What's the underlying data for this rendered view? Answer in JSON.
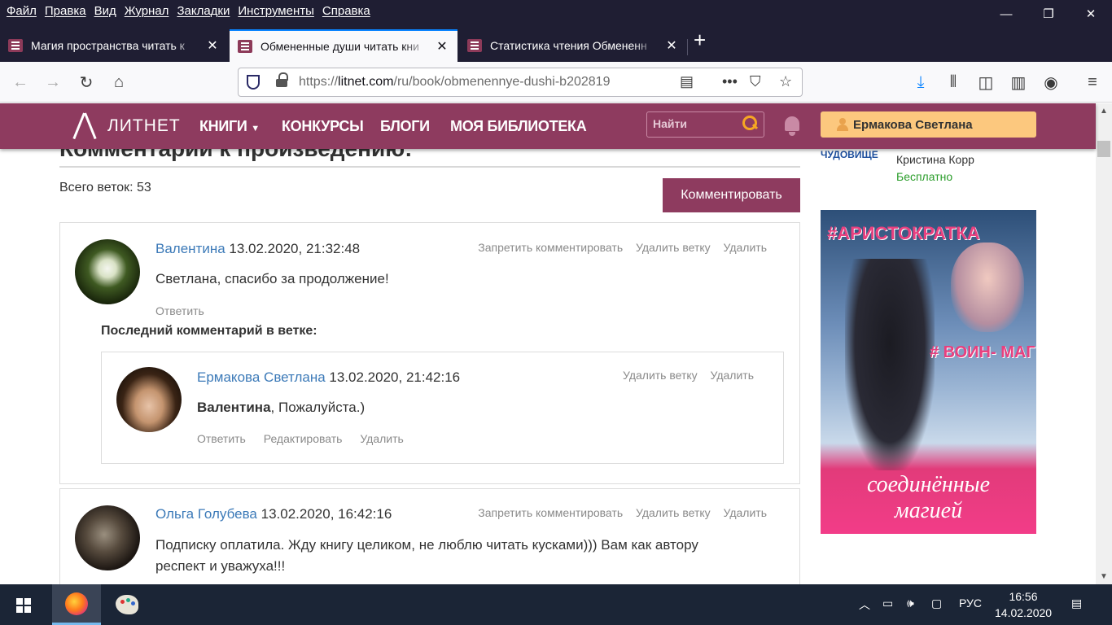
{
  "menubar": {
    "items": [
      "Файл",
      "Правка",
      "Вид",
      "Журнал",
      "Закладки",
      "Инструменты",
      "Справка"
    ]
  },
  "tabs": [
    {
      "title": "Магия пространства читать к",
      "active": false
    },
    {
      "title": "Обмененные души читать кни",
      "active": true
    },
    {
      "title": "Статистика чтения Обмененн",
      "active": false
    }
  ],
  "urlbar": {
    "prefix": "https://",
    "domain": "litnet.com",
    "path": "/ru/book/obmenennye-dushi-b202819"
  },
  "site": {
    "logo": "ЛИТНЕТ",
    "nav": [
      "КНИГИ",
      "КОНКУРСЫ",
      "БЛОГИ",
      "МОЯ БИБЛИОТЕКА"
    ],
    "search_placeholder": "Найти",
    "user": "Ермакова Светлана"
  },
  "page": {
    "heading": "Комментарии к произведению:",
    "total_threads": "Всего веток: 53",
    "comment_button": "Комментировать",
    "last_comment_label": "Последний комментарий в ветке:"
  },
  "comments": [
    {
      "author": "Валентина",
      "date": "13.02.2020, 21:32:48",
      "text": "Светлана, спасибо за продолжение!",
      "actions": [
        "Запретить комментировать",
        "Удалить ветку",
        "Удалить"
      ],
      "links": [
        "Ответить"
      ]
    },
    {
      "author": "Ермакова Светлана",
      "date": "13.02.2020, 21:42:16",
      "mention": "Валентина",
      "text": ", Пожалуйста.)",
      "actions": [
        "Удалить ветку",
        "Удалить"
      ],
      "links": [
        "Ответить",
        "Редактировать",
        "Удалить"
      ]
    },
    {
      "author": "Ольга Голубева",
      "date": "13.02.2020, 16:42:16",
      "text_line1": "Подписку оплатила. Жду книгу целиком, не люблю читать кусками))) Вам как автору",
      "text_line2": "респект и уважуха!!!",
      "actions": [
        "Запретить комментировать",
        "Удалить ветку",
        "Удалить"
      ]
    }
  ],
  "sidebar": {
    "book_thumb": "ЧУДОВИЩЕ",
    "book_author": "Кристина Корр",
    "book_price": "Бесплатно",
    "banner": {
      "tag1": "#АРИСТОКРАТКА",
      "tag2": "# ВОИН- МАГ",
      "subtitle_line1": "соединённые",
      "subtitle_line2": "магией"
    }
  },
  "taskbar": {
    "lang": "РУС",
    "time": "16:56",
    "date": "14.02.2020"
  },
  "colors": {
    "brand": "#8e3b5f",
    "accent": "#fcc87e",
    "link": "#3c7ab8"
  }
}
